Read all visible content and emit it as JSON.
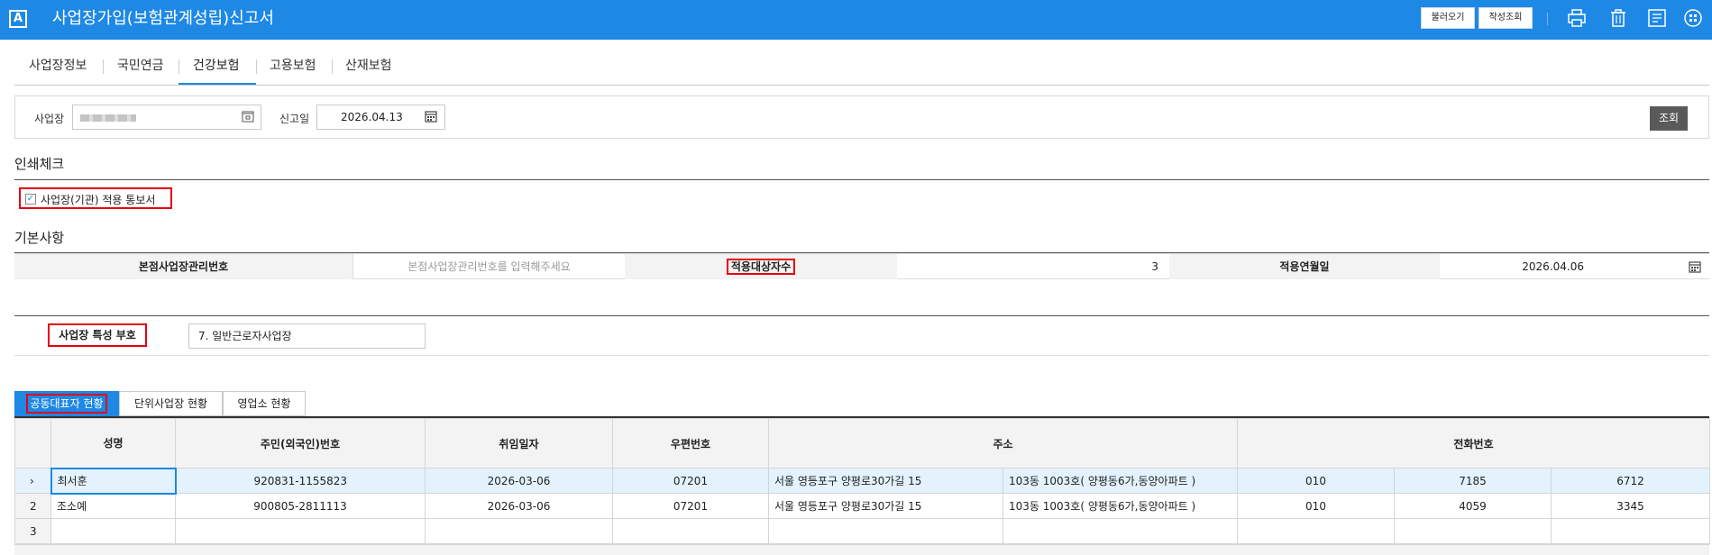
{
  "app": {
    "logo_letter": "A",
    "title": "사업장가입(보험관계성립)신고서"
  },
  "toolbar": {
    "load_label": "불러오기",
    "history_label": "작성조회",
    "icons": [
      "print-icon",
      "trash-icon",
      "list-icon",
      "grid-icon"
    ]
  },
  "tabs": [
    {
      "label": "사업장정보",
      "active": false
    },
    {
      "label": "국민연금",
      "active": false
    },
    {
      "label": "건강보험",
      "active": true
    },
    {
      "label": "고용보험",
      "active": false
    },
    {
      "label": "산재보험",
      "active": false
    }
  ],
  "search": {
    "workplace_label": "사업장",
    "report_date_label": "신고일",
    "report_date_value": "2026.04.13",
    "query_button": "조회"
  },
  "print_check": {
    "title": "인쇄체크",
    "notice_label": "사업장(기관) 적용 통보서",
    "checked": true
  },
  "basic": {
    "title": "기본사항",
    "hq_no_label": "본점사업장관리번호",
    "hq_no_placeholder": "본점사업장관리번호를 입력해주세요",
    "target_count_label": "적용대상자수",
    "target_count_value": "3",
    "apply_date_label": "적용연월일",
    "apply_date_value": "2026.04.06"
  },
  "characteristic": {
    "label": "사업장 특성 부호",
    "value": "7. 일반근로자사업장"
  },
  "subtabs": [
    {
      "label": "공동대표자 현황",
      "active": true
    },
    {
      "label": "단위사업장 현황",
      "active": false
    },
    {
      "label": "영업소 현황",
      "active": false
    }
  ],
  "grid": {
    "headers": {
      "name": "성명",
      "rrn": "주민(외국인)번호",
      "join_date": "취임일자",
      "postcode": "우편번호",
      "address": "주소",
      "phone": "전화번호"
    },
    "rows": [
      {
        "marker": "›",
        "name": "최서훈",
        "rrn": "920831-1155823",
        "join_date": "2026-03-06",
        "postcode": "07201",
        "addr1": "서울 영등포구 양평로30가길 15",
        "addr2": "103동 1003호( 양평동6가,동양아파트 )",
        "tel1": "010",
        "tel2": "7185",
        "tel3": "6712"
      },
      {
        "marker": "2",
        "name": "조소예",
        "rrn": "900805-2811113",
        "join_date": "2026-03-06",
        "postcode": "07201",
        "addr1": "서울 영등포구 양평로30가길 15",
        "addr2": "103동 1003호( 양평동6가,동양아파트 )",
        "tel1": "010",
        "tel2": "4059",
        "tel3": "3345"
      },
      {
        "marker": "3",
        "name": "",
        "rrn": "",
        "join_date": "",
        "postcode": "",
        "addr1": "",
        "addr2": "",
        "tel1": "",
        "tel2": "",
        "tel3": ""
      }
    ]
  }
}
